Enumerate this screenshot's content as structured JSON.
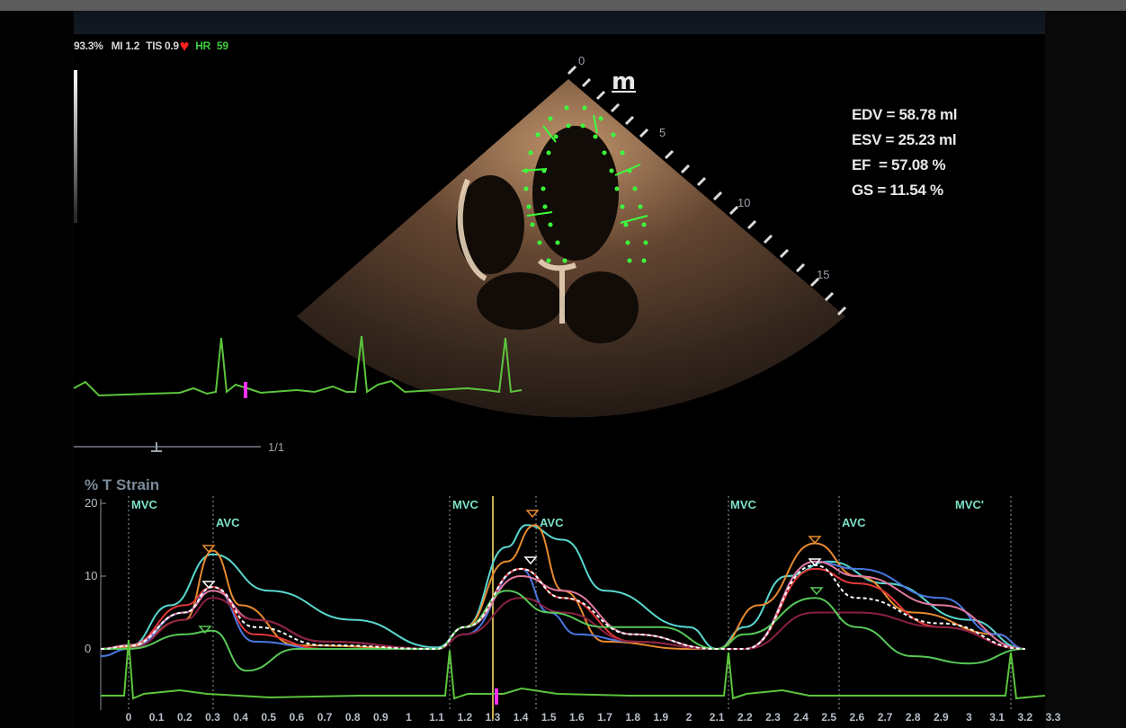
{
  "status_bar": {
    "segment1": "93.3%",
    "segment2": "MI 1.2",
    "segment3": "TIS 0.9",
    "hr_label": "HR",
    "hr_value": "59"
  },
  "measurements": {
    "edv": "EDV = 58.78 ml",
    "esv": "ESV = 25.23 ml",
    "ef": "EF  = 57.08 %",
    "gs": "GS = 11.54 %"
  },
  "probe_marker": "m",
  "depth_scale": [
    "0",
    "5",
    "10",
    "15"
  ],
  "frame_counter": "1/1",
  "strain_graph": {
    "title": "% T Strain",
    "y_ticks": [
      "20",
      "10",
      "0"
    ],
    "events": [
      "MVC",
      "AVC",
      "MVC",
      "AVC",
      "MVC",
      "AVC",
      "MVC'"
    ],
    "x_ticks": [
      "0",
      "0.1",
      "0.2",
      "0.3",
      "0.4",
      "0.5",
      "0.6",
      "0.7",
      "0.8",
      "0.9",
      "1",
      "1.1",
      "1.2",
      "1.3",
      "1.4",
      "1.5",
      "1.6",
      "1.7",
      "1.8",
      "1.9",
      "2",
      "2.1",
      "2.2",
      "2.3",
      "2.4",
      "2.5",
      "2.6",
      "2.7",
      "2.8",
      "2.9",
      "3",
      "3.1",
      "3.2",
      "3.3"
    ]
  },
  "colors": {
    "ecg": "#5cc43c",
    "contour": "#3cff3c",
    "heart": "#ff2020",
    "cursor": "#c8b050",
    "marker": "#ff30ff"
  },
  "chart_data": {
    "type": "line",
    "title": "% T Strain",
    "xlabel": "",
    "ylabel": "",
    "xlim": [
      0,
      3.3
    ],
    "ylim": [
      -7,
      20
    ],
    "series": [
      {
        "color": "#5ad8d0",
        "x": [
          -0.3,
          0,
          0.15,
          0.3,
          0.5,
          0.8,
          1.1,
          1.2,
          1.35,
          1.42,
          1.55,
          1.7,
          2.0,
          2.1,
          2.2,
          2.35,
          2.5,
          2.7,
          3.0,
          3.2
        ],
        "y": [
          0,
          0.3,
          6,
          13,
          8,
          4,
          0.2,
          3,
          14,
          17,
          15,
          8,
          3,
          0,
          3,
          10,
          12,
          9,
          4,
          0
        ]
      },
      {
        "color": "#e88a30",
        "x": [
          -0.3,
          0,
          0.2,
          0.3,
          0.4,
          0.6,
          1.1,
          1.2,
          1.35,
          1.45,
          1.55,
          1.7,
          2.0,
          2.1,
          2.25,
          2.45,
          2.6,
          2.8,
          3.1,
          3.2
        ],
        "y": [
          0,
          0.3,
          4,
          13.5,
          6,
          0.5,
          0,
          3,
          12,
          17,
          8,
          1,
          0,
          0,
          6,
          14.5,
          10,
          5,
          2,
          0
        ]
      },
      {
        "color": "#4a78e0",
        "x": [
          -0.3,
          0,
          0.2,
          0.3,
          0.45,
          0.7,
          1.1,
          1.2,
          1.4,
          1.5,
          1.6,
          1.8,
          2.1,
          2.2,
          2.45,
          2.6,
          2.9,
          3.1,
          3.2
        ],
        "y": [
          -1,
          0,
          5,
          8.5,
          1,
          0,
          0,
          2,
          11,
          5,
          2,
          1,
          0,
          0,
          12,
          11,
          7,
          2,
          0
        ]
      },
      {
        "color": "#e03838",
        "x": [
          -0.3,
          0,
          0.2,
          0.3,
          0.45,
          0.7,
          1.1,
          1.2,
          1.4,
          1.55,
          1.8,
          2.1,
          2.2,
          2.45,
          2.6,
          2.9,
          3.2
        ],
        "y": [
          0,
          0.5,
          6,
          8.5,
          2,
          0,
          0,
          3,
          11,
          7,
          1,
          0,
          0,
          11,
          9,
          3,
          0
        ]
      },
      {
        "color": "#e07aa0",
        "x": [
          -0.3,
          0,
          0.2,
          0.3,
          0.45,
          0.7,
          1.1,
          1.2,
          1.4,
          1.55,
          1.8,
          2.1,
          2.2,
          2.45,
          2.6,
          2.9,
          3.2
        ],
        "y": [
          0,
          0.5,
          5,
          8,
          4,
          1,
          0,
          3,
          10,
          8,
          2,
          0,
          0,
          12,
          10,
          6,
          0
        ]
      },
      {
        "color": "#8a2040",
        "x": [
          -0.3,
          0,
          0.2,
          0.3,
          0.45,
          0.7,
          1.1,
          1.2,
          1.4,
          1.55,
          1.8,
          2.1,
          2.2,
          2.45,
          2.6,
          2.9,
          3.2
        ],
        "y": [
          0,
          0,
          4,
          7,
          4,
          1,
          0,
          2,
          7,
          5,
          1,
          0,
          0,
          5,
          5,
          3,
          0
        ]
      },
      {
        "color": "#58c858",
        "x": [
          -0.3,
          0,
          0.2,
          0.3,
          0.42,
          0.6,
          0.8,
          1.1,
          1.2,
          1.35,
          1.5,
          1.7,
          1.9,
          2.1,
          2.2,
          2.45,
          2.6,
          2.8,
          3.0,
          3.2
        ],
        "y": [
          0,
          0,
          2,
          2.5,
          -3,
          0,
          0,
          0,
          3,
          8,
          5,
          3,
          3,
          0,
          2,
          7,
          3,
          -1,
          -2,
          0
        ]
      },
      {
        "color": "#ffffff",
        "dashed": true,
        "x": [
          -0.3,
          0,
          0.2,
          0.3,
          0.45,
          0.7,
          1.1,
          1.2,
          1.4,
          1.55,
          1.8,
          2.1,
          2.2,
          2.45,
          2.6,
          2.9,
          3.2
        ],
        "y": [
          0,
          0.4,
          5,
          8.5,
          3,
          0.5,
          0,
          3,
          11,
          7,
          2,
          0,
          0,
          11.5,
          7,
          3.5,
          0
        ]
      }
    ]
  }
}
